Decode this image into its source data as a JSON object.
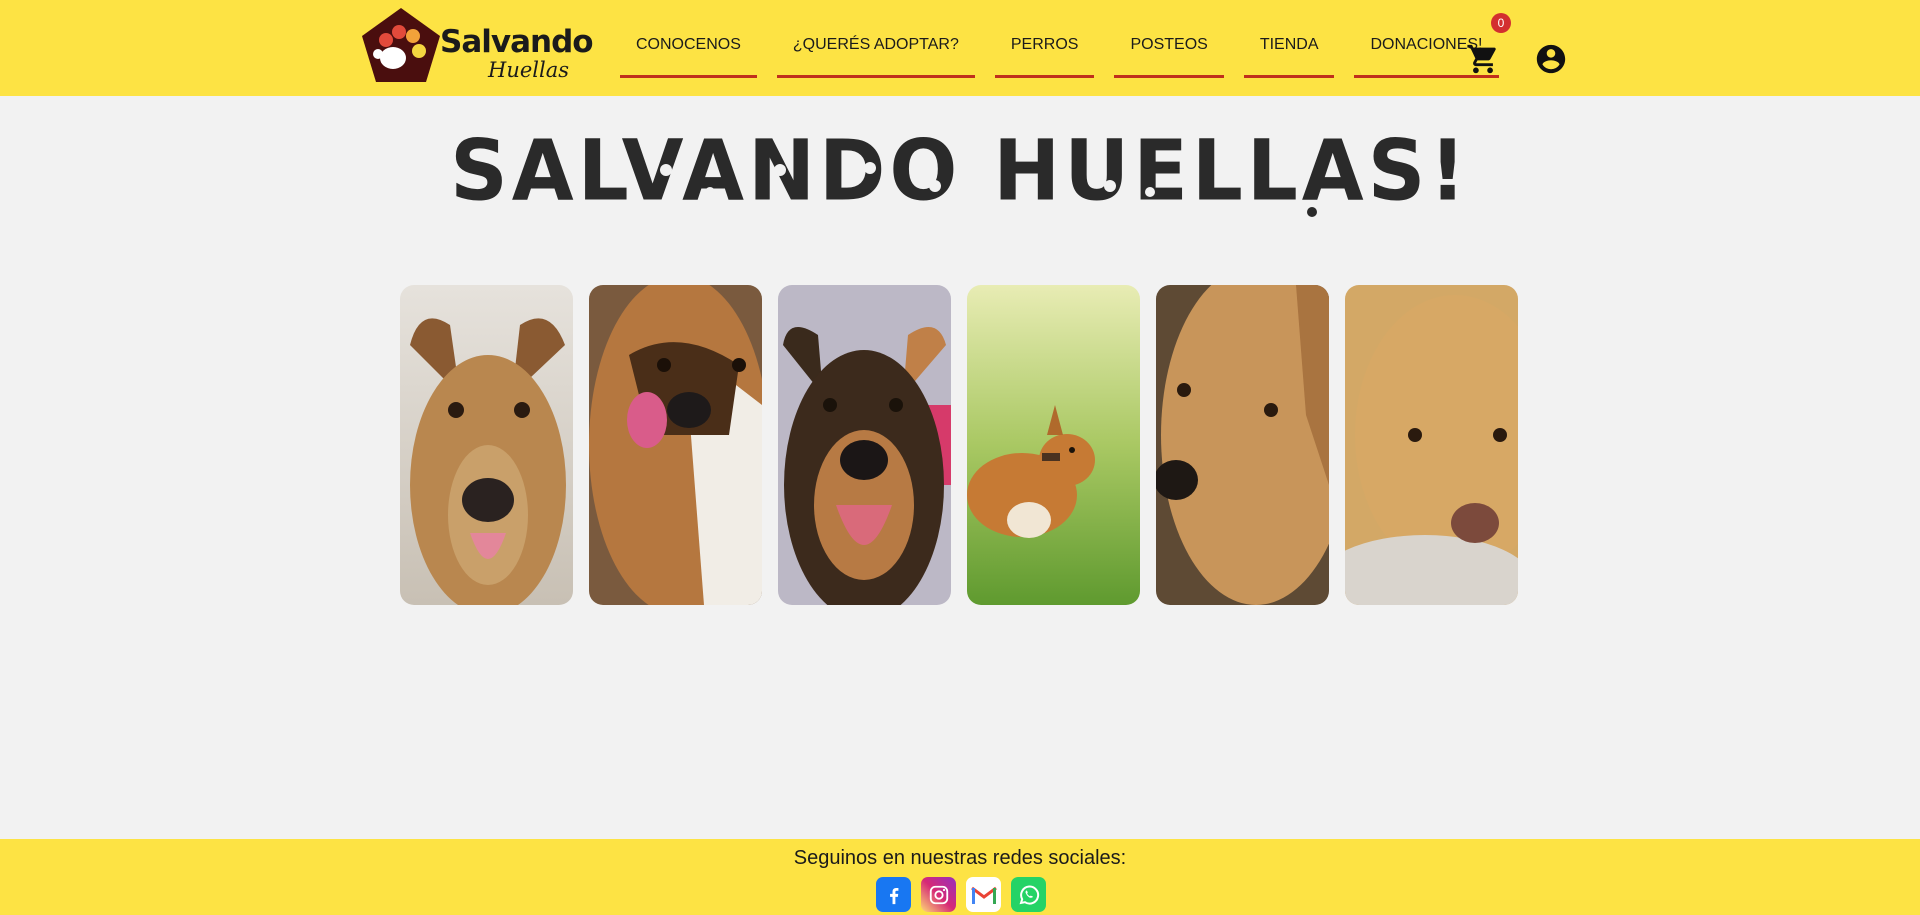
{
  "header": {
    "logo": {
      "word1": "Salvando",
      "word2": "Huellas"
    },
    "nav": [
      {
        "label": "CONOCENOS"
      },
      {
        "label": "¿QUERÉS ADOPTAR?"
      },
      {
        "label": "PERROS"
      },
      {
        "label": "POSTEOS"
      },
      {
        "label": "TIENDA"
      },
      {
        "label": "DONACIONES!"
      }
    ],
    "cart_count": "0",
    "icons": {
      "cart": "shopping-cart-icon",
      "account": "account-circle-icon"
    },
    "accent_color": "#fde344",
    "underline_color": "#c0301c"
  },
  "hero": {
    "title": "SALVANDO HUELLAS!"
  },
  "gallery": {
    "items": [
      {
        "alt": "dog-photo-1"
      },
      {
        "alt": "dog-photo-2"
      },
      {
        "alt": "dog-photo-3"
      },
      {
        "alt": "dog-photo-4"
      },
      {
        "alt": "dog-photo-5"
      },
      {
        "alt": "dog-photo-6"
      }
    ]
  },
  "footer": {
    "title": "Seguinos en nuestras redes sociales:",
    "socials": [
      "facebook-icon",
      "instagram-icon",
      "gmail-icon",
      "whatsapp-icon"
    ]
  }
}
